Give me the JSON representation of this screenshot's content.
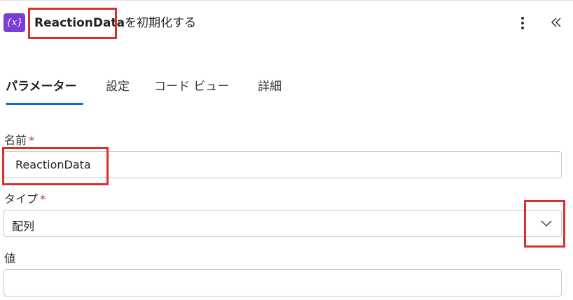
{
  "header": {
    "icon_text": "{x}",
    "title_bold": "ReactionData",
    "title_rest": "を初期化する"
  },
  "tabs": [
    {
      "label": "パラメーター",
      "active": true
    },
    {
      "label": "設定",
      "active": false
    },
    {
      "label": "コード ビュー",
      "active": false
    },
    {
      "label": "詳細",
      "active": false
    }
  ],
  "fields": {
    "name": {
      "label": "名前",
      "required_mark": "*",
      "value": "ReactionData"
    },
    "type": {
      "label": "タイプ",
      "required_mark": "*",
      "value": "配列"
    },
    "value": {
      "label": "値",
      "value": ""
    }
  },
  "colors": {
    "accent": "#1a66d6",
    "icon_bg": "#7a3dd8",
    "highlight": "#d9302c",
    "required": "#c4314b"
  },
  "icons": [
    "variable-icon",
    "more-options-icon",
    "collapse-panel-icon",
    "chevron-down-icon"
  ]
}
